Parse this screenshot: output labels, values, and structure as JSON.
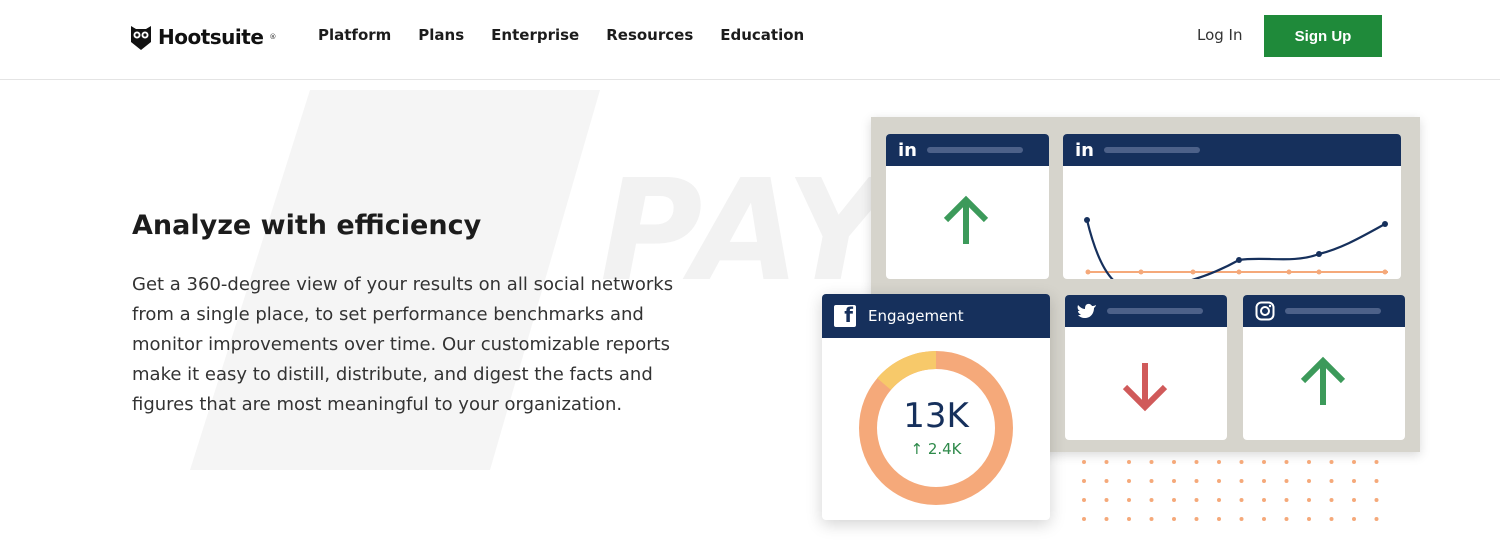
{
  "header": {
    "logo_text": "Hootsuite",
    "logo_mark": "®",
    "nav": [
      "Platform",
      "Plans",
      "Enterprise",
      "Resources",
      "Education"
    ],
    "login_label": "Log In",
    "signup_label": "Sign Up"
  },
  "hero": {
    "title": "Analyze with efficiency",
    "body": "Get a 360-degree view of your results on all social networks from a single place, to set performance benchmarks and monitor improvements over time. Our customizable reports make it easy to distill, distribute, and digest the facts and figures that are most meaningful to your organization."
  },
  "watermark": {
    "text": "PAYMENT"
  },
  "dashboard": {
    "engagement_label": "Engagement",
    "engagement_value": "13K",
    "engagement_delta": "↑ 2.4K",
    "linkedin_label": "in",
    "colors": {
      "navy": "#16305c",
      "green": "#3c9a5a",
      "red": "#d05a5a",
      "orange": "#f5a97a",
      "yellow": "#f7c96a"
    }
  },
  "icons": [
    "hootsuite-owl-icon",
    "linkedin-icon",
    "facebook-icon",
    "twitter-icon",
    "instagram-icon",
    "arrow-up-icon",
    "arrow-down-icon"
  ]
}
